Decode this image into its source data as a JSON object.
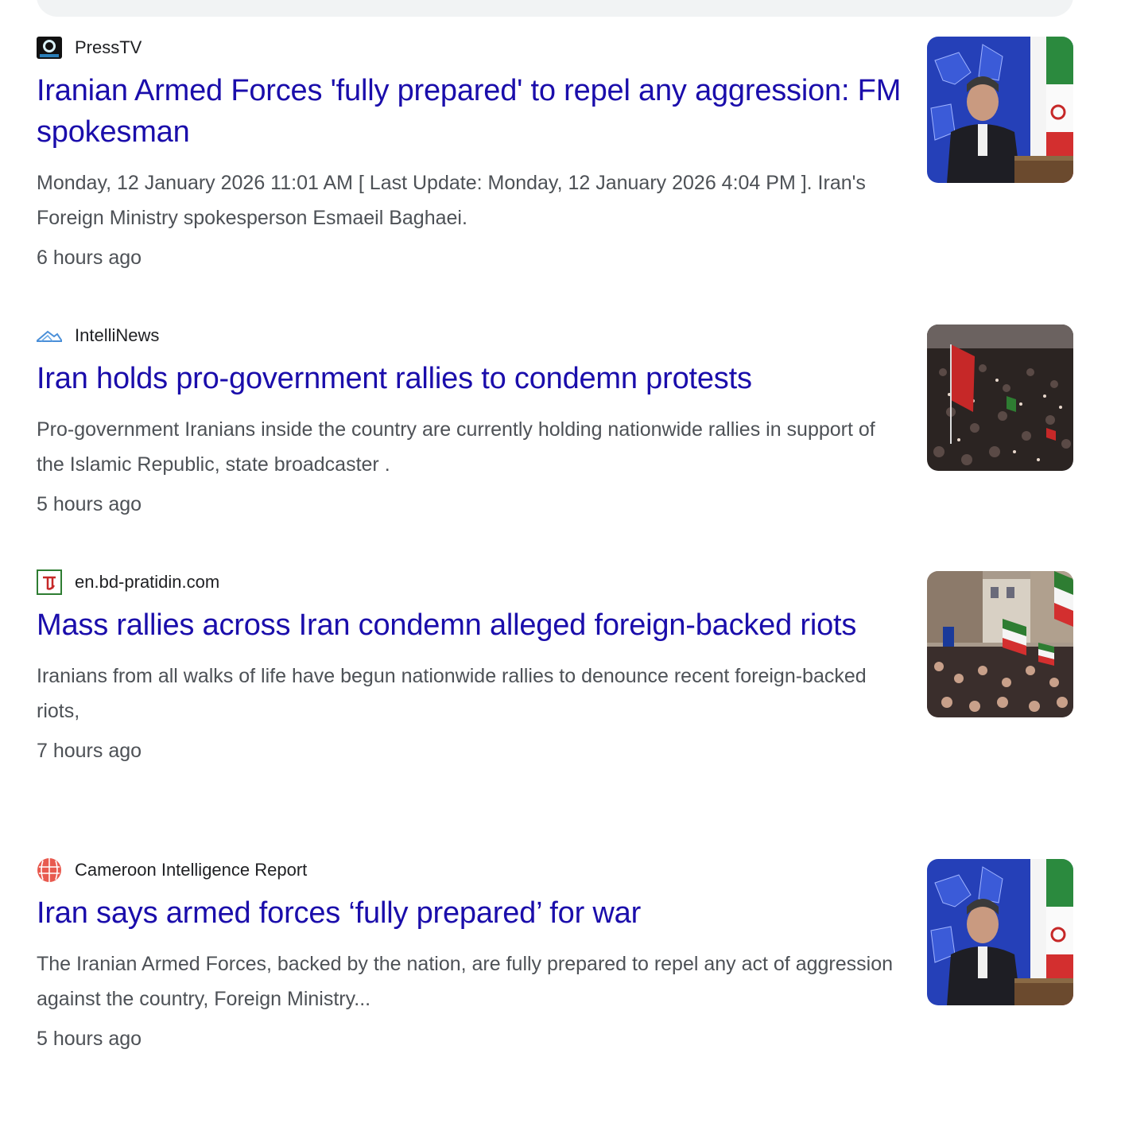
{
  "results": [
    {
      "source": "PressTV",
      "favicon": "presstv-logo-icon",
      "headline": "Iranian Armed Forces 'fully prepared' to repel any aggression: FM spokesman",
      "snippet": "Monday, 12 January 2026 11:01 AM [ Last Update: Monday, 12 January 2026 4:04 PM ]. Iran's Foreign Ministry spokesperson Esmaeil Baghaei.",
      "time": "6 hours ago",
      "thumbnail": "spokesman-podium-image"
    },
    {
      "source": "IntelliNews",
      "favicon": "intellinews-logo-icon",
      "headline": "Iran holds pro-government rallies to condemn protests",
      "snippet": "Pro-government Iranians inside the country are currently holding nationwide rallies in support of the Islamic Republic, state broadcaster .",
      "time": "5 hours ago",
      "thumbnail": "crowd-rally-image"
    },
    {
      "source": "en.bd-pratidin.com",
      "favicon": "bd-pratidin-logo-icon",
      "headline": "Mass rallies across Iran condemn alleged foreign-backed riots",
      "snippet": "Iranians from all walks of life have begun nationwide rallies to denounce recent foreign-backed riots,",
      "time": "7 hours ago",
      "thumbnail": "street-rally-flags-image"
    },
    {
      "source": "Cameroon Intelligence Report",
      "favicon": "cameroon-report-logo-icon",
      "headline": "Iran says armed forces ‘fully prepared’ for war",
      "snippet": "The Iranian Armed Forces, backed by the nation, are fully prepared to repel any act of aggression against the country, Foreign Ministry...",
      "time": "5 hours ago",
      "thumbnail": "spokesman-podium-image"
    }
  ],
  "colors": {
    "headline": "#1a0dab",
    "snippet": "#4d5156",
    "source": "#202124"
  }
}
